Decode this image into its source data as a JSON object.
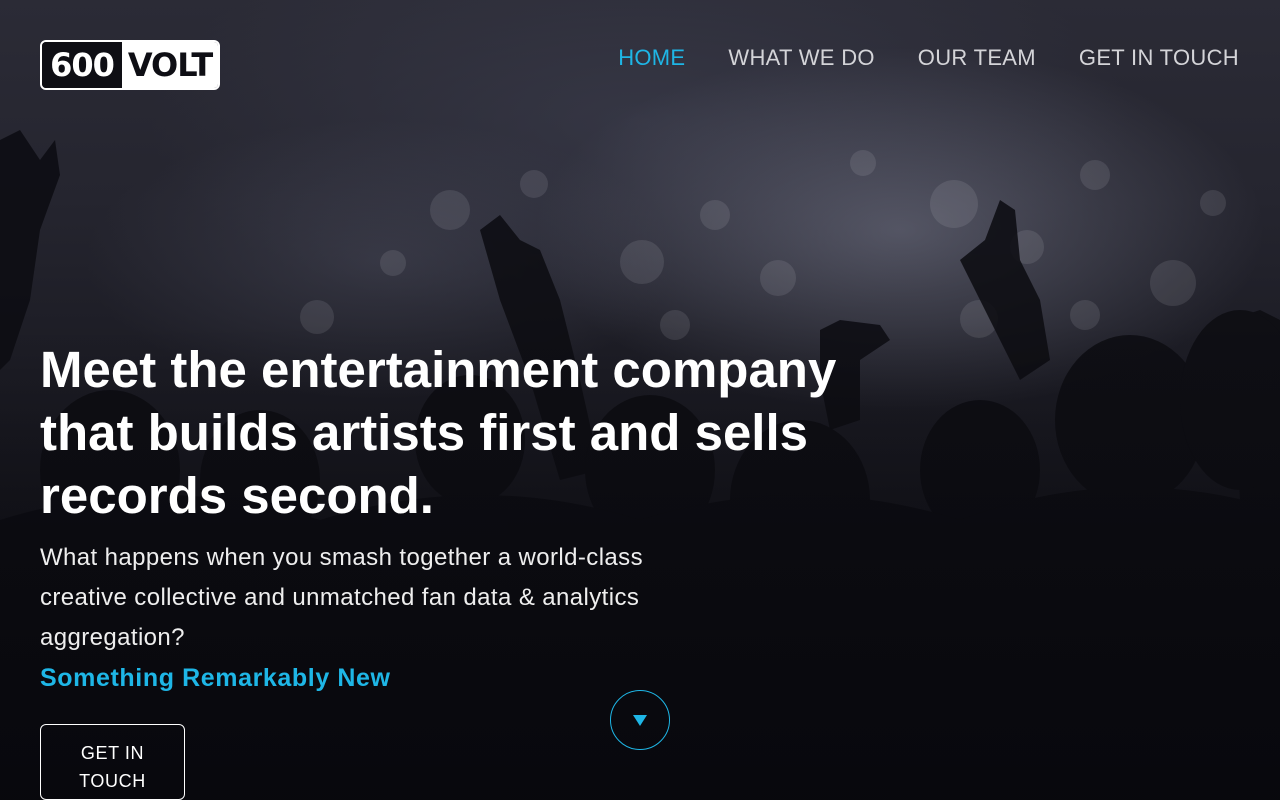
{
  "brand": {
    "logo_number": "600",
    "logo_word": "VOLT"
  },
  "nav": {
    "items": [
      {
        "label": "HOME",
        "active": true
      },
      {
        "label": "WHAT WE DO",
        "active": false
      },
      {
        "label": "OUR TEAM",
        "active": false
      },
      {
        "label": "GET IN TOUCH",
        "active": false
      }
    ]
  },
  "hero": {
    "headline": "Meet the entertainment company that builds artists first and sells records second.",
    "subtext": "What happens when you smash together a world-class creative collective and unmatched fan data & analytics aggregation?",
    "tagline": "Something Remarkably New",
    "cta_line1": "GET IN",
    "cta_line2": "TOUCH",
    "scroll_icon": "chevron-down-icon"
  },
  "colors": {
    "accent": "#1eb6e6",
    "text": "#ffffff",
    "nav_text": "#d4d4d8",
    "background": "#0e0e14"
  }
}
